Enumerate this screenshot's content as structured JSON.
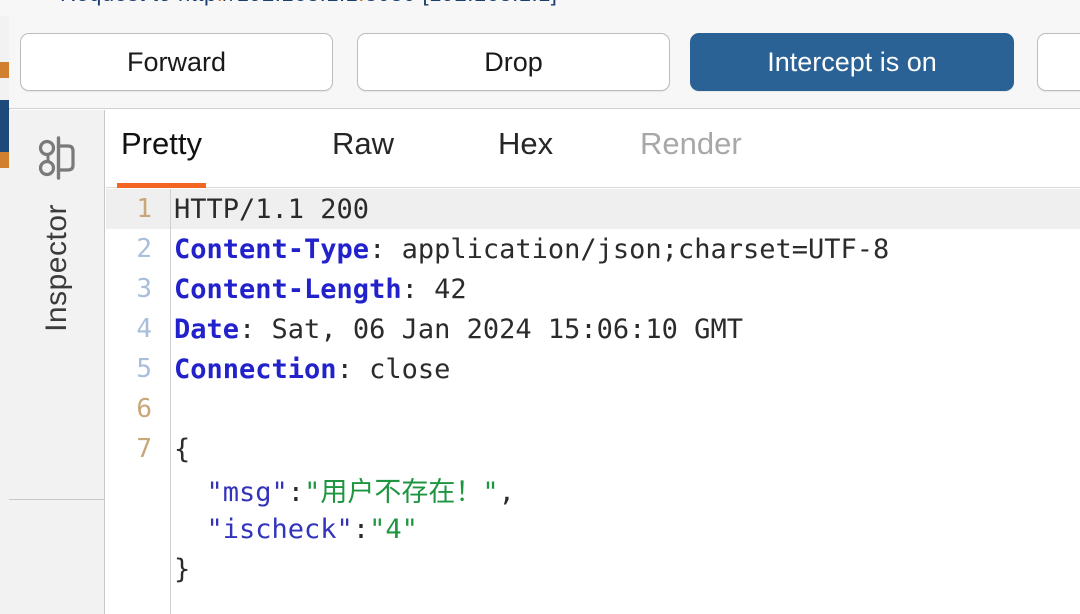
{
  "clipped_top": {
    "text": "Request to http://",
    "visible": "partially cut off descender row"
  },
  "toolbar": {
    "forward_label": "Forward",
    "drop_label": "Drop",
    "intercept_label": "Intercept is on",
    "extra_label": "",
    "primary_color": "#2b6295"
  },
  "sidebar": {
    "icon_name": "detective-incognito-icon",
    "label": "Inspector"
  },
  "message_view": {
    "tabs": [
      {
        "label": "Pretty",
        "state": "active"
      },
      {
        "label": "Raw",
        "state": "normal"
      },
      {
        "label": "Hex",
        "state": "normal"
      },
      {
        "label": "Render",
        "state": "disabled"
      }
    ],
    "active_tab_underline_color": "#f26522"
  },
  "response": {
    "lines": [
      {
        "number": "1",
        "kind": "status",
        "highlight": true,
        "text": "HTTP/1.1 200"
      },
      {
        "number": "2",
        "kind": "header",
        "highlight": false,
        "name": "Content-Type",
        "value": "application/json;charset=UTF-8"
      },
      {
        "number": "3",
        "kind": "header",
        "highlight": false,
        "name": "Content-Length",
        "value": "42"
      },
      {
        "number": "4",
        "kind": "header",
        "highlight": false,
        "name": "Date",
        "value": "Sat, 06 Jan 2024 15:06:10 GMT"
      },
      {
        "number": "5",
        "kind": "header",
        "highlight": false,
        "name": "Connection",
        "value": "close"
      },
      {
        "number": "6",
        "kind": "blank",
        "highlight": false,
        "text": ""
      },
      {
        "number": "7",
        "kind": "body",
        "highlight": false,
        "text": "{"
      }
    ],
    "body": {
      "open_brace": "{",
      "close_brace": "}",
      "entries": [
        {
          "key": "\"msg\"",
          "colon": ":",
          "value": "\"用户不存在！\"",
          "trailing": ","
        },
        {
          "key": "\"ischeck\"",
          "colon": ":",
          "value": "\"4\"",
          "trailing": ""
        }
      ]
    },
    "status_line": "HTTP/1.1 200",
    "headers": {
      "Content-Type": "application/json;charset=UTF-8",
      "Content-Length": "42",
      "Date": "Sat, 06 Jan 2024 15:06:10 GMT",
      "Connection": "close"
    },
    "json_body": {
      "msg": "用户不存在！",
      "ischeck": "4"
    }
  }
}
